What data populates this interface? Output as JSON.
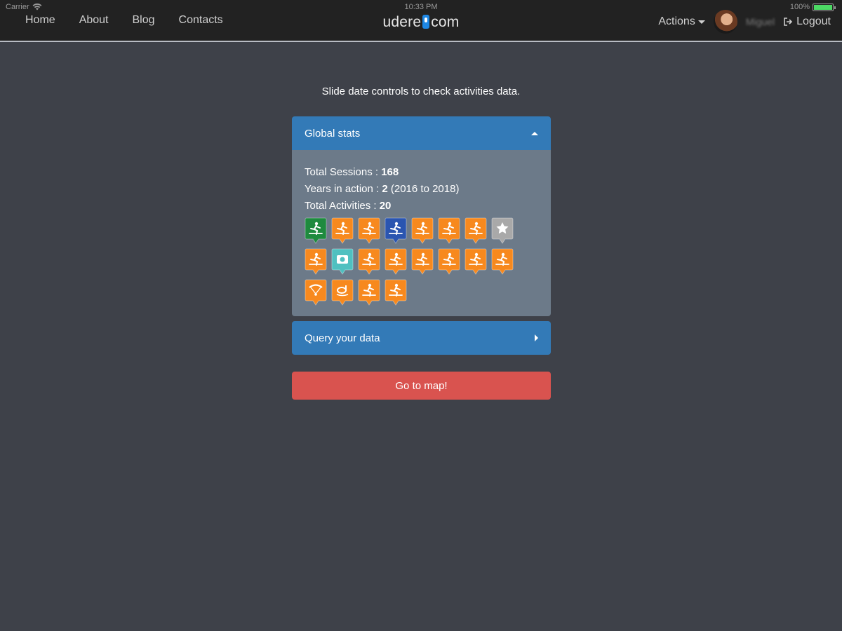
{
  "status_bar": {
    "carrier": "Carrier",
    "time": "10:33 PM",
    "battery": "100%"
  },
  "nav": {
    "links": [
      "Home",
      "About",
      "Blog",
      "Contacts"
    ],
    "brand_left": "udere",
    "brand_right": "com",
    "actions_label": "Actions",
    "username": "Miguel",
    "logout_label": "Logout"
  },
  "hint": "Slide date controls to check activities data.",
  "global_stats": {
    "title": "Global stats",
    "sessions_label": "Total Sessions : ",
    "sessions_value": "168",
    "years_label": "Years in action : ",
    "years_value": "2",
    "years_range": " (2016 to 2018)",
    "activities_label": "Total Activities : ",
    "activities_value": "20",
    "activity_icons": [
      {
        "name": "kitesurf-icon",
        "color": "#1e8a3e"
      },
      {
        "name": "rafting-icon",
        "color": "#f7891e"
      },
      {
        "name": "windsurf-icon",
        "color": "#f7891e"
      },
      {
        "name": "fishing-icon",
        "color": "#2a55b0"
      },
      {
        "name": "skiing-icon",
        "color": "#f7891e"
      },
      {
        "name": "climbing-icon",
        "color": "#f7891e"
      },
      {
        "name": "yoga-icon",
        "color": "#f7891e"
      },
      {
        "name": "favorite-star-icon",
        "color": "#a9a9a9"
      },
      {
        "name": "paddleboard-icon",
        "color": "#f7891e"
      },
      {
        "name": "camera-icon",
        "color": "#4fc0c0"
      },
      {
        "name": "kayak-icon",
        "color": "#f7891e"
      },
      {
        "name": "meditation-icon",
        "color": "#f7891e"
      },
      {
        "name": "sailing-icon",
        "color": "#f7891e"
      },
      {
        "name": "wakeboard-icon",
        "color": "#f7891e"
      },
      {
        "name": "running-icon",
        "color": "#f7891e"
      },
      {
        "name": "snowboard-icon",
        "color": "#f7891e"
      },
      {
        "name": "paragliding-icon",
        "color": "#f7891e"
      },
      {
        "name": "snorkeling-icon",
        "color": "#f7891e"
      },
      {
        "name": "cross-country-ski-icon",
        "color": "#f7891e"
      },
      {
        "name": "stretching-icon",
        "color": "#f7891e"
      }
    ]
  },
  "query": {
    "title": "Query your data"
  },
  "go_button": "Go to map!",
  "colors": {
    "panel_header": "#337ab7",
    "panel_body": "#6c7a89",
    "danger": "#d9534f",
    "background": "#3e4149",
    "navbar": "#222222"
  }
}
